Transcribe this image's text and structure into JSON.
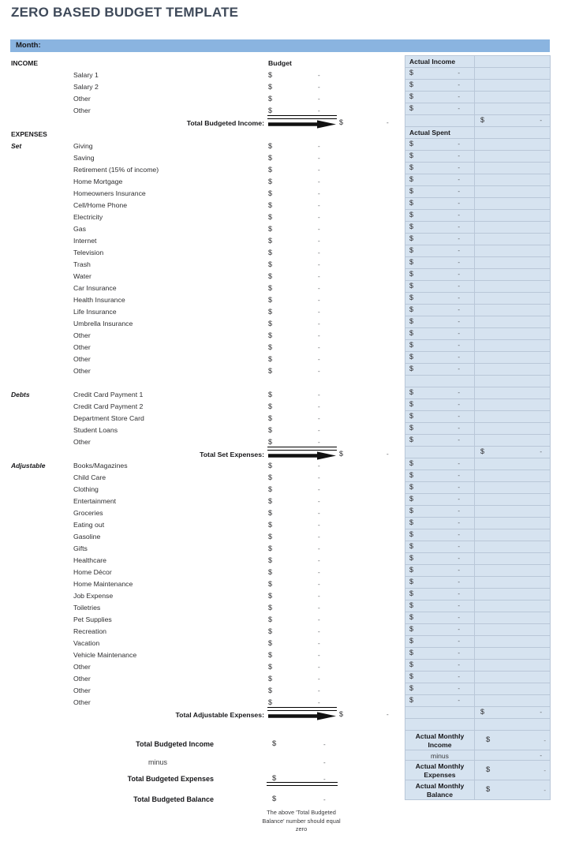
{
  "title": "ZERO BASED BUDGET TEMPLATE",
  "month_label": "Month:",
  "colors": {
    "header_blue": "#8ab4e0",
    "cell_blue": "#d6e3f0",
    "title": "#3f4a5a",
    "grid": "#b9c7d8"
  },
  "symbols": {
    "dollar": "$",
    "dash": "-",
    "minus": "minus"
  },
  "sections": {
    "income": {
      "heading": "INCOME",
      "budget_header": "Budget",
      "actual_header": "Actual Income",
      "items": [
        "Salary 1",
        "Salary 2",
        "Other",
        "Other"
      ],
      "total_label": "Total Budgeted Income:"
    },
    "expenses": {
      "heading": "EXPENSES",
      "actual_header": "Actual Spent",
      "set": {
        "label": "Set",
        "items": [
          "Giving",
          "Saving",
          "Retirement (15% of income)",
          "Home Mortgage",
          "Homeowners Insurance",
          "Cell/Home Phone",
          "Electricity",
          "Gas",
          "Internet",
          "Television",
          "Trash",
          "Water",
          "Car Insurance",
          "Health Insurance",
          "Life Insurance",
          "Umbrella Insurance",
          "Other",
          "Other",
          "Other",
          "Other"
        ]
      },
      "debts": {
        "label": "Debts",
        "items": [
          "Credit Card Payment 1",
          "Credit Card Payment 2",
          "Department Store Card",
          "Student Loans",
          "Other"
        ]
      },
      "set_total_label": "Total Set Expenses:",
      "adjustable": {
        "label": "Adjustable",
        "items": [
          "Books/Magazines",
          "Child Care",
          "Clothing",
          "Entertainment",
          "Groceries",
          "Eating out",
          "Gasoline",
          "Gifts",
          "Healthcare",
          "Home Décor",
          "Home Maintenance",
          "Job Expense",
          "Toiletries",
          "Pet Supplies",
          "Recreation",
          "Vacation",
          "Vehicle Maintenance",
          "Other",
          "Other",
          "Other",
          "Other"
        ]
      },
      "adjustable_total_label": "Total Adjustable Expenses:"
    },
    "summary_budgeted": {
      "income_label": "Total Budgeted Income",
      "minus_label": "minus",
      "expenses_label": "Total Budgeted Expenses",
      "balance_label": "Total Budgeted Balance",
      "footnote": "The above 'Total Budgeted Balance' number should equal zero"
    },
    "summary_actual": {
      "income_label": "Actual Monthly Income",
      "minus_label": "minus",
      "expenses_label": "Actual Monthly Expenses",
      "balance_label": "Actual Monthly Balance"
    }
  }
}
